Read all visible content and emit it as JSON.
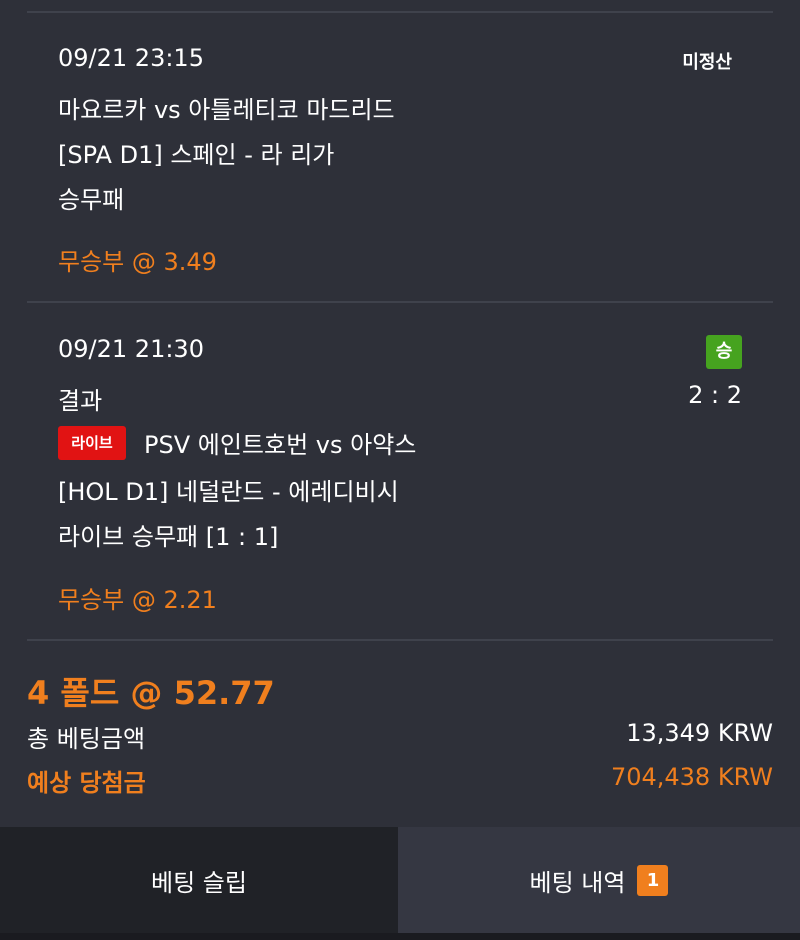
{
  "bets": [
    {
      "datetime": "09/21 23:15",
      "status": "미정산",
      "match": "마요르카 vs 아틀레티코 마드리드",
      "league": "[SPA D1] 스페인 - 라 리가",
      "market": "승무패",
      "pick": "무승부 @ 3.49"
    },
    {
      "datetime": "09/21 21:30",
      "status": "승",
      "result_label": "결과",
      "score": "2 : 2",
      "live_label": "라이브",
      "match": "PSV 에인트호번 vs 아약스",
      "league": "[HOL D1] 네덜란드 - 에레디비시",
      "market": "라이브 승무패 [1 : 1]",
      "pick": "무승부 @ 2.21"
    }
  ],
  "summary": {
    "folds": "4 폴드 @ 52.77",
    "total_label": "총 베팅금액",
    "total_value": "13,349 KRW",
    "expected_label": "예상 당첨금",
    "expected_value": "704,438 KRW"
  },
  "tabs": {
    "slip_label": "베팅 슬립",
    "history_label": "베팅 내역",
    "history_count": "1"
  },
  "colors": {
    "background": "#2e3039",
    "accent": "#f07f1e",
    "win": "#46a31f",
    "live": "#e11313"
  }
}
